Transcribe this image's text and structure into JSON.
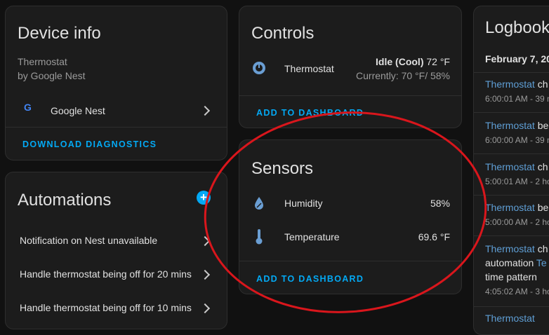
{
  "device_info": {
    "title": "Device info",
    "model": "Thermostat",
    "manufacturer": "by Google Nest",
    "integration": "Google Nest",
    "download": "DOWNLOAD DIAGNOSTICS"
  },
  "automations": {
    "title": "Automations",
    "items": [
      "Notification on Nest unavailable",
      "Handle thermostat being off for 20 mins",
      "Handle thermostat being off for 10 mins"
    ]
  },
  "controls": {
    "title": "Controls",
    "entity": "Thermostat",
    "state_label": "Idle (Cool)",
    "state_temp": "72 °F",
    "current": "Currently: 70 °F/ 58%",
    "add": "ADD TO DASHBOARD"
  },
  "sensors": {
    "title": "Sensors",
    "items": [
      {
        "name": "Humidity",
        "value": "58%"
      },
      {
        "name": "Temperature",
        "value": "69.6 °F"
      }
    ],
    "add": "ADD TO DASHBOARD"
  },
  "logbook": {
    "title": "Logbook",
    "date": "February 7, 20",
    "entries": [
      {
        "entity": "Thermostat",
        "rest": " ch",
        "time": "6:00:01 AM - 39 m"
      },
      {
        "entity": "Thermostat",
        "rest": " be",
        "time": "6:00:00 AM - 39 m"
      },
      {
        "entity": "Thermostat",
        "rest": " ch",
        "time": "5:00:01 AM - 2 ho"
      },
      {
        "entity": "Thermostat",
        "rest": " be",
        "time": "5:00:00 AM - 2 ho"
      }
    ],
    "last": {
      "entity": "Thermostat",
      "rest": " ch",
      "line2a": "automation ",
      "line2b": "Te",
      "line3": "time pattern",
      "time": "4:05:02 AM - 3 ho"
    },
    "partial": "Thermostat"
  },
  "colors": {
    "accent": "#03a9f4",
    "annotation": "#d9161c",
    "card": "#1c1c1c",
    "background": "#111111"
  }
}
